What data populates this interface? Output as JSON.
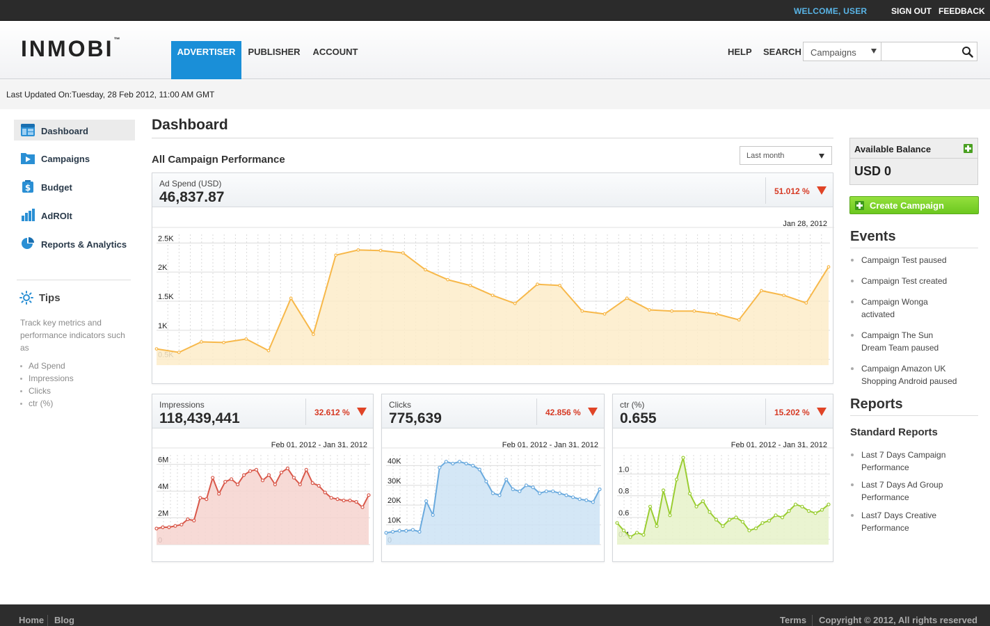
{
  "topbar": {
    "welcome": "WELCOME, USER",
    "sign_out": "SIGN OUT",
    "feedback": "FEEDBACK"
  },
  "header": {
    "logo": "INMOBI",
    "logo_tm": "™",
    "tabs": [
      {
        "label": "ADVERTISER",
        "active": true
      },
      {
        "label": "PUBLISHER",
        "active": false
      },
      {
        "label": "ACCOUNT",
        "active": false
      }
    ],
    "help": "HELP",
    "search_label": "SEARCH",
    "search_scope": "Campaigns",
    "search_placeholder": ""
  },
  "last_updated": "Last Updated On:Tuesday, 28 Feb 2012, 11:00 AM GMT",
  "sidebar": {
    "items": [
      {
        "label": "Dashboard",
        "icon": "dashboard-icon",
        "active": true
      },
      {
        "label": "Campaigns",
        "icon": "campaigns-folder-icon",
        "active": false
      },
      {
        "label": "Budget",
        "icon": "budget-dollar-icon",
        "active": false
      },
      {
        "label": "AdROIt",
        "icon": "bar-chart-icon",
        "active": false
      },
      {
        "label": "Reports & Analytics",
        "icon": "pie-chart-icon",
        "active": false
      }
    ],
    "tips": {
      "title": "Tips",
      "text": "Track key metrics and performance indicators such as",
      "items": [
        "Ad Spend",
        "Impressions",
        "Clicks",
        "ctr (%)"
      ]
    }
  },
  "main": {
    "title": "Dashboard",
    "section": "All Campaign Performance",
    "range": "Last month"
  },
  "colors": {
    "accent": "#1a8fd8",
    "spend": "#f7b84a",
    "impressions": "#d9584a",
    "clicks": "#6aaade",
    "ctr": "#9acd32",
    "down": "#e04426"
  },
  "chart_data": [
    {
      "type": "area",
      "label": "Ad Spend (USD)",
      "value": "46,837.87",
      "change": "51.012 %",
      "date": "Jan 28, 2012",
      "y_ticks": [
        "0.5K",
        "1K",
        "1.5K",
        "2K",
        "2.5K"
      ],
      "ylim": [
        400,
        2600
      ],
      "values": [
        680,
        620,
        800,
        790,
        850,
        650,
        1550,
        930,
        2290,
        2380,
        2370,
        2330,
        2040,
        1870,
        1770,
        1600,
        1460,
        1790,
        1770,
        1330,
        1280,
        1550,
        1350,
        1330,
        1330,
        1280,
        1180,
        1680,
        1600,
        1470,
        2090
      ]
    },
    {
      "type": "area",
      "label": "Impressions",
      "value": "118,439,441",
      "change": "32.612 %",
      "date": "Feb 01, 2012 - Jan 31, 2012",
      "y_ticks": [
        "0",
        "2M",
        "4M",
        "6M"
      ],
      "ylim": [
        0,
        6500000
      ],
      "values": [
        1200000,
        1300000,
        1300000,
        1400000,
        1500000,
        1900000,
        1800000,
        3500000,
        3400000,
        5000000,
        3800000,
        4700000,
        4900000,
        4500000,
        5200000,
        5500000,
        5600000,
        4800000,
        5200000,
        4500000,
        5400000,
        5700000,
        5000000,
        4500000,
        5600000,
        4600000,
        4400000,
        3900000,
        3500000,
        3400000,
        3300000,
        3300000,
        3200000,
        2800000,
        3700000
      ]
    },
    {
      "type": "area",
      "label": "Clicks",
      "value": "775,639",
      "change": "42.856 %",
      "date": "Feb 01, 2012 - Jan 31, 2012",
      "y_ticks": [
        "0",
        "10K",
        "20K",
        "30K",
        "40K"
      ],
      "ylim": [
        0,
        44000
      ],
      "values": [
        6000,
        6500,
        7000,
        7000,
        7500,
        6500,
        22000,
        15000,
        39000,
        42000,
        41000,
        42000,
        41000,
        40000,
        38000,
        32000,
        26000,
        25000,
        33000,
        28000,
        27000,
        30000,
        29000,
        26000,
        27000,
        27000,
        26000,
        25000,
        24000,
        23000,
        22500,
        21500,
        28000
      ]
    },
    {
      "type": "area",
      "label": "ctr (%)",
      "value": "0.655",
      "change": "15.202 %",
      "date": "Feb 01, 2012 - Jan 31, 2012",
      "y_ticks": [
        "0.4",
        "0.6",
        "0.8",
        "1.0"
      ],
      "ylim": [
        0.35,
        1.15
      ],
      "values": [
        0.55,
        0.48,
        0.42,
        0.46,
        0.44,
        0.7,
        0.52,
        0.85,
        0.62,
        0.95,
        1.15,
        0.82,
        0.7,
        0.75,
        0.65,
        0.58,
        0.52,
        0.58,
        0.6,
        0.56,
        0.48,
        0.5,
        0.55,
        0.57,
        0.62,
        0.6,
        0.66,
        0.72,
        0.7,
        0.66,
        0.64,
        0.67,
        0.72
      ]
    }
  ],
  "balance": {
    "title": "Available Balance",
    "value": "USD 0"
  },
  "create_campaign": "Create Campaign",
  "events": {
    "title": "Events",
    "items": [
      {
        "lines": [
          "Campaign Test paused"
        ]
      },
      {
        "lines": [
          "Campaign Test created"
        ]
      },
      {
        "lines": [
          "Campaign Wonga",
          "activated"
        ]
      },
      {
        "lines": [
          "Campaign The Sun",
          "Dream Team paused"
        ]
      },
      {
        "lines": [
          "Campaign Amazon UK",
          "Shopping Android paused"
        ]
      }
    ]
  },
  "reports": {
    "title": "Reports",
    "subtitle": "Standard Reports",
    "items": [
      {
        "lines": [
          "Last 7 Days Campaign",
          "Performance"
        ]
      },
      {
        "lines": [
          "Last 7 Days Ad Group",
          "Performance"
        ]
      },
      {
        "lines": [
          "Last7 Days Creative",
          "Performance"
        ]
      }
    ]
  },
  "footer": {
    "home": "Home",
    "blog": "Blog",
    "terms": "Terms",
    "copyright": "Copyright © 2012, All rights reserved"
  }
}
